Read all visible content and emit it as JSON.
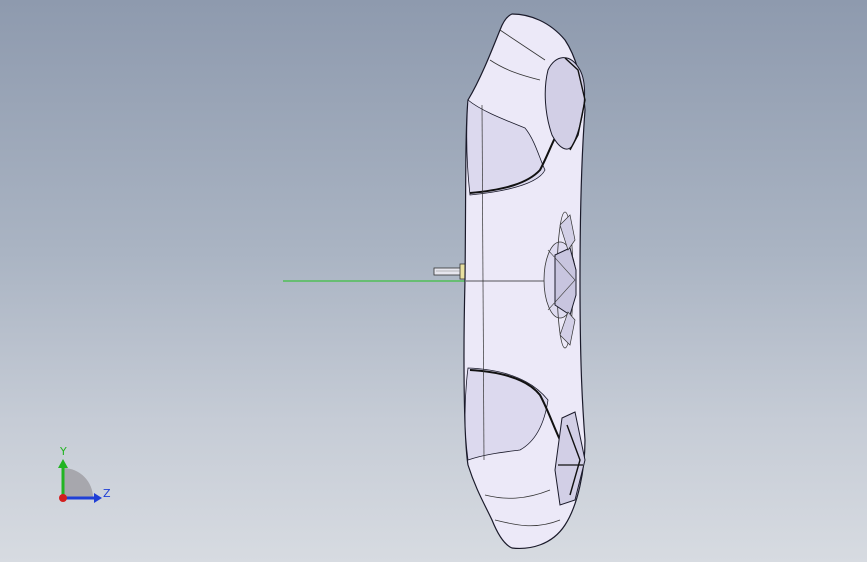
{
  "viewport": {
    "background_top": "#8e9aae",
    "background_bottom": "#d7dbe1"
  },
  "model": {
    "body_fill": "#ece9f8",
    "shade_fill": "#d2cfe6",
    "edge_color": "#1a1a2a",
    "axis_line_color": "#1fc21f"
  },
  "triad": {
    "y_label": "Y",
    "z_label": "Z",
    "y_color": "#22b422",
    "z_color": "#1f3fd6",
    "x_color": "#d21e1e"
  }
}
